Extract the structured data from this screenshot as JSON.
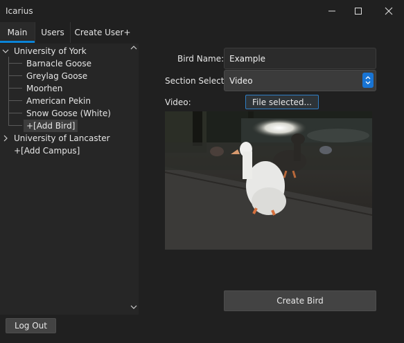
{
  "window": {
    "title": "Icarius",
    "minimize_icon": "minimize-icon",
    "maximize_icon": "maximize-icon",
    "close_icon": "close-icon"
  },
  "tabs": [
    {
      "label": "Main",
      "active": true
    },
    {
      "label": "Users",
      "active": false
    },
    {
      "label": "Create User+",
      "active": false
    }
  ],
  "tree": {
    "campuses": [
      {
        "label": "University of York",
        "expanded": true,
        "birds": [
          "Barnacle Goose",
          "Greylag Goose",
          "Moorhen",
          "American Pekin",
          "Snow Goose (White)"
        ],
        "add_bird": "+[Add Bird]"
      },
      {
        "label": "University of Lancaster",
        "expanded": false
      }
    ],
    "add_campus": "+[Add Campus]"
  },
  "form": {
    "bird_name_label": "Bird Name:",
    "bird_name_value": "Example",
    "section_label": "Section Select:",
    "section_value": "Video",
    "video_label": "Video:",
    "file_button": "File selected...",
    "create_button": "Create Bird"
  },
  "footer": {
    "logout_button": "Log Out"
  },
  "colors": {
    "accent": "#0a84d8",
    "background": "#202020",
    "panel": "#262626"
  }
}
